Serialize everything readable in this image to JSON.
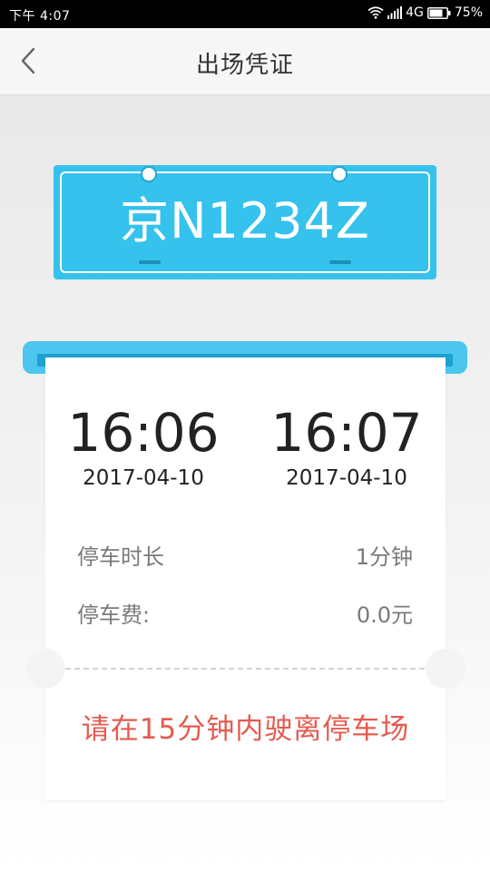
{
  "status_bar": {
    "time": "下午 4:07",
    "network": "4G",
    "battery": "75%"
  },
  "header": {
    "title": "出场凭证"
  },
  "plate": {
    "number": "京N1234Z",
    "color": "#35c2ec"
  },
  "receipt": {
    "entry_time": "16:06",
    "entry_date": "2017-04-10",
    "exit_time": "16:07",
    "exit_date": "2017-04-10",
    "rows": [
      {
        "label": "停车时长",
        "value": "1分钟"
      },
      {
        "label": "停车费:",
        "value": "0.0元"
      }
    ],
    "notice": "请在15分钟内驶离停车场",
    "notice_color": "#e55a4f"
  },
  "icons": {
    "back": "chevron-left-icon",
    "wifi": "wifi-icon",
    "signal": "signal-icon",
    "battery": "battery-icon"
  }
}
